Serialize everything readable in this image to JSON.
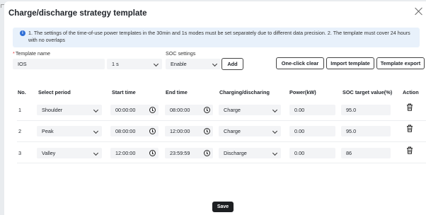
{
  "dialog": {
    "title": "Charge/discharge strategy template",
    "notice": "1. The settings of the time-of-use power templates in the 30min and 1s modes must be set separately due to different data precision. 2. The template must cover 24 hours with no overlaps"
  },
  "form": {
    "template_name_label": "Template name",
    "template_name_required": "*",
    "template_name_value": "IOS",
    "mode_value": "1 s",
    "soc_settings_label": "SOC settings",
    "soc_settings_value": "Enable",
    "add_label": "Add"
  },
  "toolbar": {
    "one_click_clear": "One-click clear",
    "import_template": "Import template",
    "template_export": "Template export"
  },
  "table": {
    "headers": [
      "No.",
      "Select period",
      "Start time",
      "End time",
      "Charging/discharing",
      "Power(kW)",
      "SOC target value(%)",
      "Action"
    ],
    "rows": [
      {
        "no": "1",
        "period": "Shoulder",
        "start": "00:00:00",
        "end": "08:00:00",
        "mode": "Charge",
        "power": "0.00",
        "soc": "95.0"
      },
      {
        "no": "2",
        "period": "Peak",
        "start": "08:00:00",
        "end": "12:00:00",
        "mode": "Charge",
        "power": "0.00",
        "soc": "95.0"
      },
      {
        "no": "3",
        "period": "Valley",
        "start": "12:00:00",
        "end": "23:59:59",
        "mode": "Discharge",
        "power": "0.00",
        "soc": "86"
      }
    ]
  },
  "footer": {
    "save_label": "Save"
  },
  "icons": {
    "info": "info-icon",
    "close": "close-icon",
    "clock": "clock-icon",
    "trash": "trash-icon",
    "chevron": "chevron-down-icon"
  },
  "colors": {
    "notice_bg": "#e8f1fb",
    "info_blue": "#2f6fd6",
    "required_red": "#e23a3a",
    "save_bg": "#1d1f22",
    "field_bg": "#f3f4f6"
  }
}
